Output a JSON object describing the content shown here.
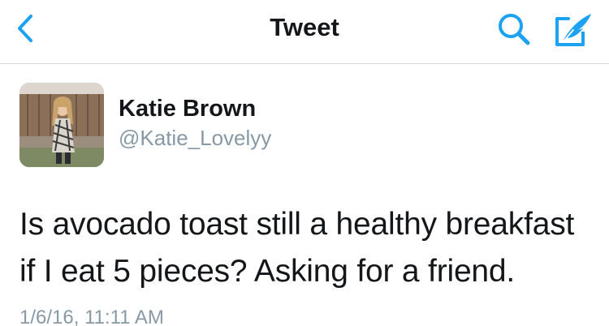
{
  "navbar": {
    "title": "Tweet",
    "back_icon": "chevron-left-icon",
    "search_icon": "search-icon",
    "compose_icon": "compose-tweet-icon",
    "accent_color": "#1da1f2"
  },
  "tweet": {
    "author": {
      "display_name": "Katie Brown",
      "handle": "@Katie_Lovelyy",
      "avatar": "profile-photo"
    },
    "text_lines": [
      "Is avocado toast still a healthy breakfast",
      "if I eat 5 pieces? Asking for a friend."
    ],
    "timestamp": "1/6/16, 11:11 AM"
  },
  "colors": {
    "text_primary": "#14171a",
    "text_secondary": "#8899a6",
    "divider": "#d7d7d9"
  }
}
